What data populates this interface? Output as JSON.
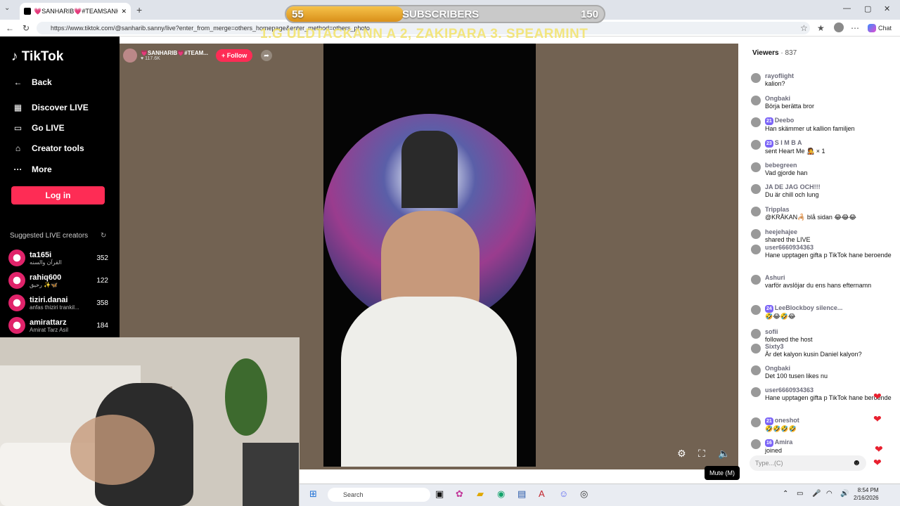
{
  "browser": {
    "tab_title": "💗SANHARIB💗#TEAMSANHARIB",
    "url": "https://www.tiktok.com/@sanharib.sanny/live?enter_from_merge=others_homepage&enter_method=others_photo",
    "chat_label": "Chat"
  },
  "overlay": {
    "sub_left": "55",
    "sub_title": "SUBSCRIBERS",
    "sub_right": "150",
    "sub_progress": 0.37,
    "ticker": "1.G ULDTACKANN A 2, ZAKIPARA  3. SPEARMINT"
  },
  "sidebar": {
    "logo": "TikTok",
    "items": [
      {
        "label": "Back",
        "icon": "arrow-left-icon"
      },
      {
        "label": "Discover LIVE",
        "icon": "calendar-icon"
      },
      {
        "label": "Go LIVE",
        "icon": "camera-icon"
      },
      {
        "label": "Creator tools",
        "icon": "lightbulb-icon"
      },
      {
        "label": "More",
        "icon": "more-icon"
      }
    ],
    "login": "Log in",
    "suggested_title": "Suggested LIVE creators",
    "creators": [
      {
        "name": "ta165i",
        "sub": "القرآن والسنه",
        "count": "352"
      },
      {
        "name": "rahiq600",
        "sub": "رحيق ✨🦋",
        "count": "122"
      },
      {
        "name": "tiziri.danai",
        "sub": "anfas thiziri trankil...",
        "count": "358"
      },
      {
        "name": "amirattarz",
        "sub": "Amirat Tarz Asil",
        "count": "184"
      }
    ]
  },
  "host": {
    "name": "💗SANHARIB💗#TEAM...",
    "likes": "♥ 117.6K",
    "follow": "+ Follow"
  },
  "video_controls": {
    "mute_tooltip": "Mute (M)"
  },
  "chat": {
    "viewers_label": "Viewers",
    "viewers_count": "· 837",
    "messages": [
      {
        "user": "rayoflight",
        "text": "kalion?",
        "badge": ""
      },
      {
        "user": "Ongbaki",
        "text": "Börja berätta bror",
        "badge": ""
      },
      {
        "user": "Deebo",
        "text": "Han skämmer ut kallion familjen",
        "badge": "21"
      },
      {
        "user": "S I M B A",
        "text": "sent Heart Me 🧑‍🎤 × 1",
        "badge": "23"
      },
      {
        "user": "bebegreen",
        "text": "Vad gjorde han",
        "badge": ""
      },
      {
        "user": "JA DE JAG OCH!!!",
        "text": "Du är chill och lung",
        "badge": ""
      },
      {
        "user": "Tripplas",
        "text": "@KRÅKAN🦂 blå sidan 😂😂😂",
        "badge": ""
      },
      {
        "user": "heejehajee",
        "text": "shared the LIVE",
        "badge": ""
      },
      {
        "user": "user6660934363",
        "text": "Hane upptagen gifta p TikTok hane beroende",
        "badge": ""
      },
      {
        "user": "Ashuri",
        "text": "varför avslöjar du ens hans efternamn",
        "badge": ""
      },
      {
        "user": "LeeBlockboy silence...",
        "text": "🤣😂🤣😂",
        "badge": "24"
      },
      {
        "user": "sofii",
        "text": "followed the host",
        "badge": ""
      },
      {
        "user": "Sixty3",
        "text": "Är det kalyon kusin Daniel kalyon?",
        "badge": ""
      },
      {
        "user": "Ongbaki",
        "text": "Det 100 tusen likes nu",
        "badge": ""
      },
      {
        "user": "user6660934363",
        "text": "Hane upptagen gifta p TikTok hane beroende",
        "badge": ""
      },
      {
        "user": "oneshot",
        "text": "🤣🤣🤣🤣",
        "badge": "21"
      },
      {
        "user": "Amira",
        "text": "joined",
        "badge": "16"
      }
    ],
    "input_placeholder": "Type...(C)"
  },
  "taskbar": {
    "search": "Search",
    "time": "8:54 PM",
    "date": "2/16/2026"
  }
}
